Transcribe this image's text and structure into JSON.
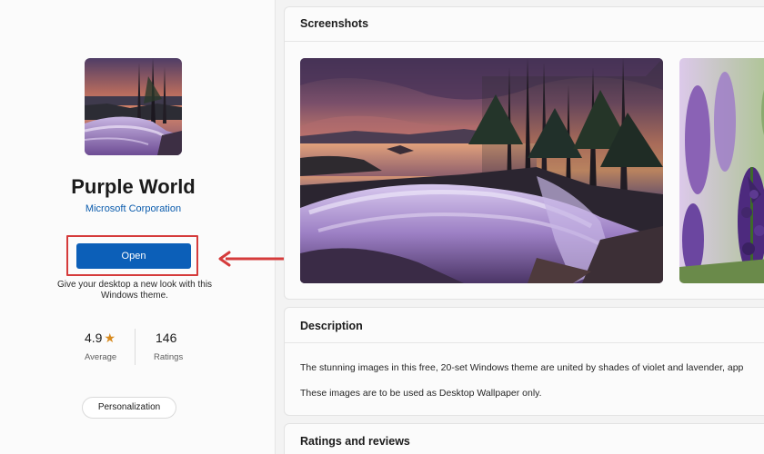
{
  "app": {
    "title": "Purple World",
    "publisher": "Microsoft Corporation",
    "open_label": "Open",
    "open_description": "Give your desktop a new look with this Windows theme.",
    "rating": "4.9",
    "rating_label": "Average",
    "ratings_count": "146",
    "ratings_count_label": "Ratings",
    "category": "Personalization"
  },
  "sections": {
    "screenshots_title": "Screenshots",
    "description_title": "Description",
    "description_p1": "The stunning images in this free, 20-set Windows theme are united by shades of violet and lavender, app",
    "description_p2": "These images are to be used as Desktop Wallpaper only.",
    "reviews_title": "Ratings and reviews"
  },
  "colors": {
    "accent": "#0c5fb8",
    "highlight": "#d53b3b",
    "star": "#d78a1e",
    "link": "#0b5cad"
  },
  "icons": {
    "star": "★",
    "annotation_arrow": "left-arrow"
  }
}
